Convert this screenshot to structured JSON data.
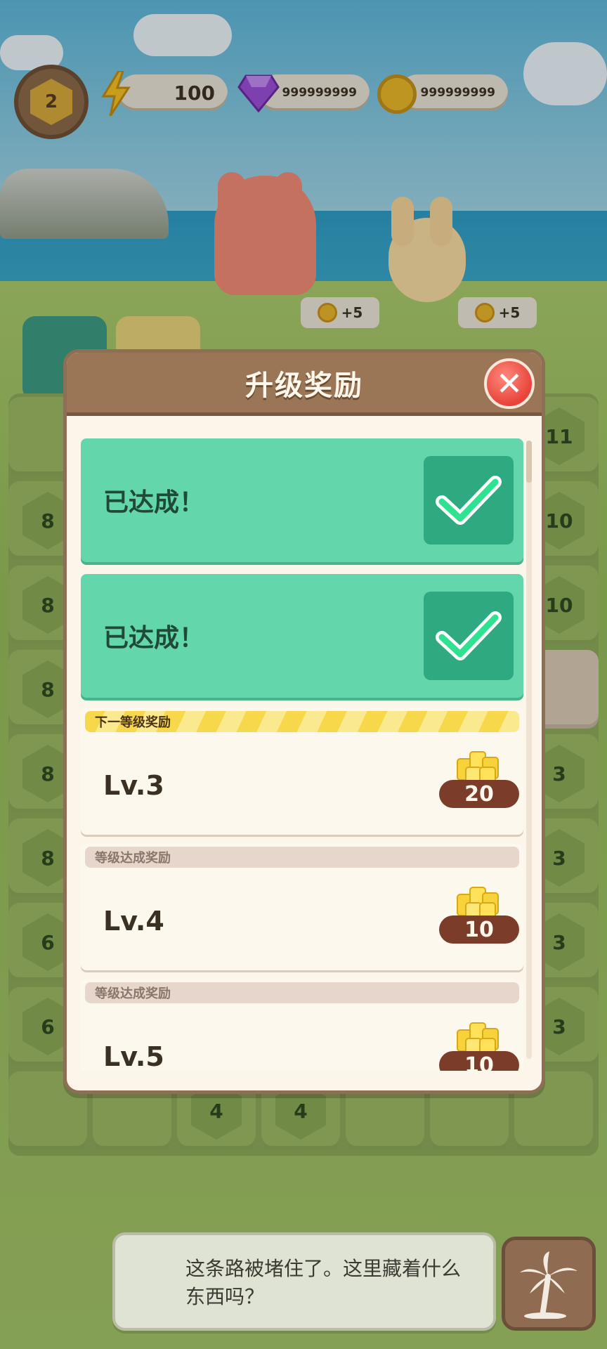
{
  "top_bar": {
    "player_level": "2",
    "energy": "100",
    "gems": "999999999",
    "coins": "999999999"
  },
  "scene": {
    "coin_chip_1": "+5",
    "coin_chip_2": "+5"
  },
  "board": {
    "tile_numbers": {
      "left": [
        "8",
        "8",
        "8",
        "8",
        "8",
        "6",
        "6"
      ],
      "right": [
        "11",
        "10",
        "10",
        "3",
        "3",
        "3",
        "3"
      ],
      "bottom": [
        "4",
        "4"
      ]
    }
  },
  "modal": {
    "title": "升级奖励",
    "completed_label": "已达成！",
    "completed_items": [
      "已达成！",
      "已达成！"
    ],
    "levels": [
      {
        "header": "下一等级奖励",
        "label": "Lv.3",
        "reward": "20",
        "kind": "next"
      },
      {
        "header": "等级达成奖励",
        "label": "Lv.4",
        "reward": "10",
        "kind": "reach"
      },
      {
        "header": "等级达成奖励",
        "label": "Lv.5",
        "reward": "10",
        "kind": "reach"
      }
    ]
  },
  "dialog": {
    "text": "这条路被堵住了。这里藏着什么东西吗？"
  },
  "colors": {
    "modal_header": "#9a7556",
    "done_green": "#63d6ab",
    "check_green": "#2fa97f",
    "reward_pill": "#7b3d2a",
    "close_red": "#e8433a"
  }
}
